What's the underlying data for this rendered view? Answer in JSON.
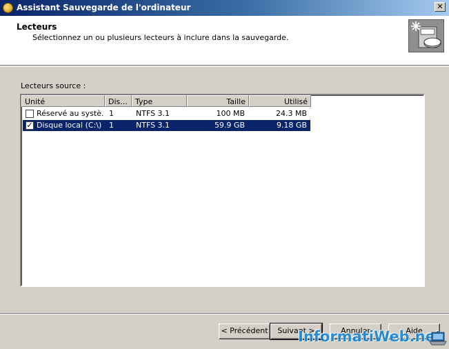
{
  "window": {
    "title": "Assistant Sauvegarde de l'ordinateur",
    "close_glyph": "✕"
  },
  "header": {
    "title": "Lecteurs",
    "subtitle": "Sélectionnez un ou plusieurs lecteurs à inclure dans la sauvegarde.",
    "icon": "backup-drive-icon"
  },
  "list": {
    "label": "Lecteurs source :",
    "columns": [
      "Unité",
      "Dis...",
      "Type",
      "Taille",
      "Utilisé"
    ],
    "rows": [
      {
        "checked": false,
        "unit": "Réservé au systè...",
        "disk": "1",
        "type": "NTFS 3.1",
        "size": "100 MB",
        "used": "24.3 MB",
        "selected": false
      },
      {
        "checked": true,
        "unit": "Disque local (C:\\)",
        "disk": "1",
        "type": "NTFS 3.1",
        "size": "59.9 GB",
        "used": "9.18 GB",
        "selected": true
      }
    ]
  },
  "buttons": {
    "back": "< Précédent",
    "next": "Suivant >",
    "cancel": "Annuler",
    "help": "Aide"
  },
  "watermark": "InformatiWeb.net",
  "colors": {
    "selection": "#0a246a",
    "titlebar_start": "#0a246a",
    "titlebar_end": "#a6caf0",
    "watermark": "#1a86d6"
  }
}
